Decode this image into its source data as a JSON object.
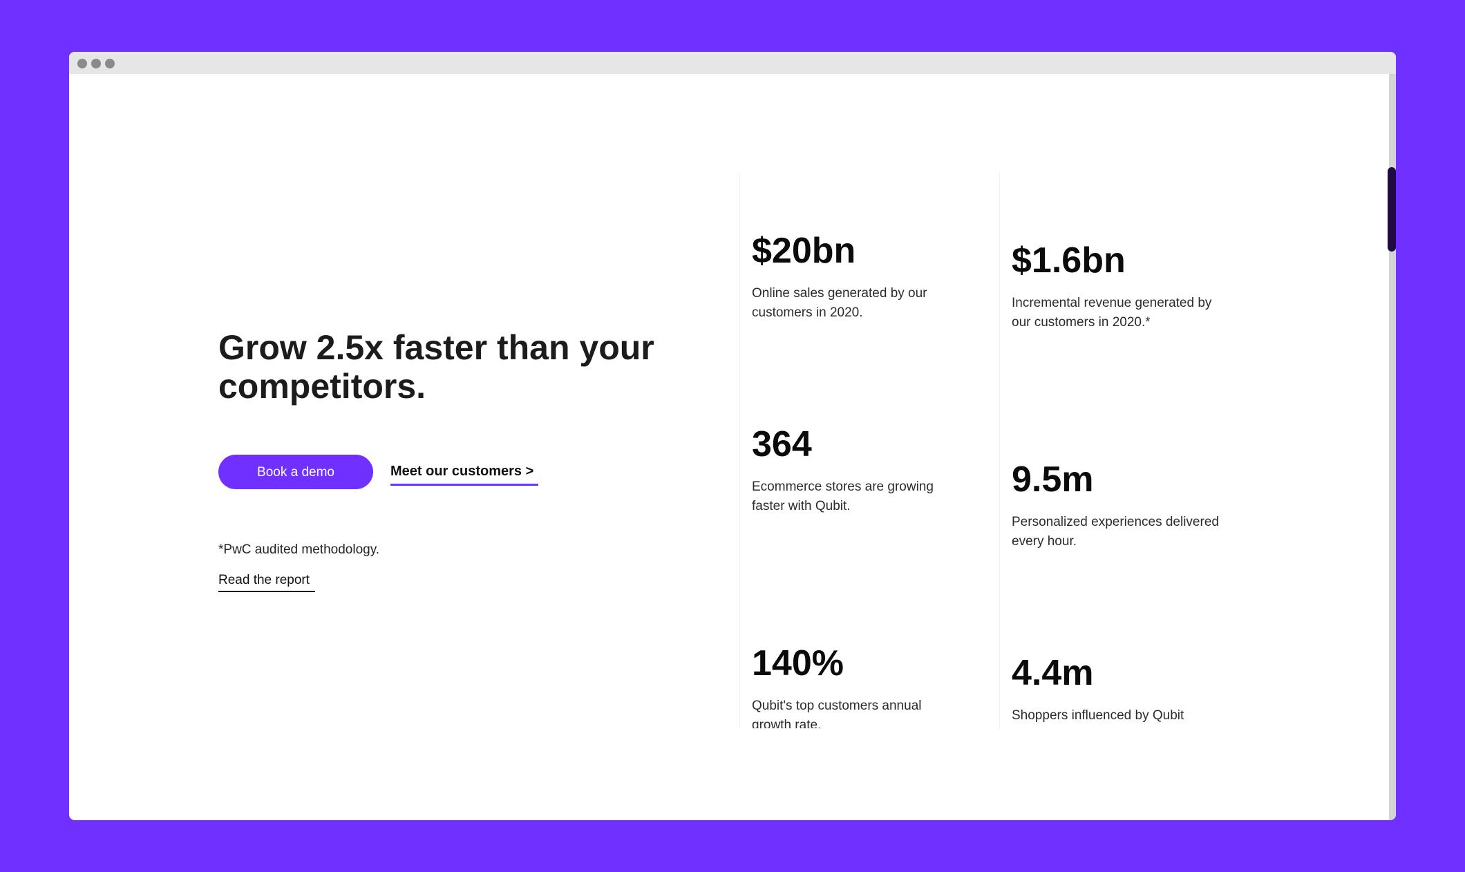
{
  "window": {
    "controls": [
      "dot",
      "dot",
      "dot"
    ]
  },
  "hero": {
    "headline": "Grow 2.5x faster than your competitors.",
    "primary_button": "Book a demo",
    "secondary_link": "Meet our customers >",
    "footnote": "*PwC audited methodology.",
    "report_link": "Read the report"
  },
  "stats": [
    {
      "value": "$20bn",
      "description": "Online sales generated by our customers in 2020."
    },
    {
      "value": "$1.6bn",
      "description": "Incremental revenue generated by our customers in 2020.*"
    },
    {
      "value": "364",
      "description": "Ecommerce stores are growing faster with Qubit."
    },
    {
      "value": "9.5m",
      "description": "Personalized experiences delivered every hour."
    },
    {
      "value": "140%",
      "description": "Qubit's top customers annual growth rate."
    },
    {
      "value": "4.4m",
      "description": "Shoppers influenced by Qubit"
    }
  ],
  "colors": {
    "accent": "#7030FF",
    "background": "#7030FF",
    "text": "#1c1c1c"
  }
}
